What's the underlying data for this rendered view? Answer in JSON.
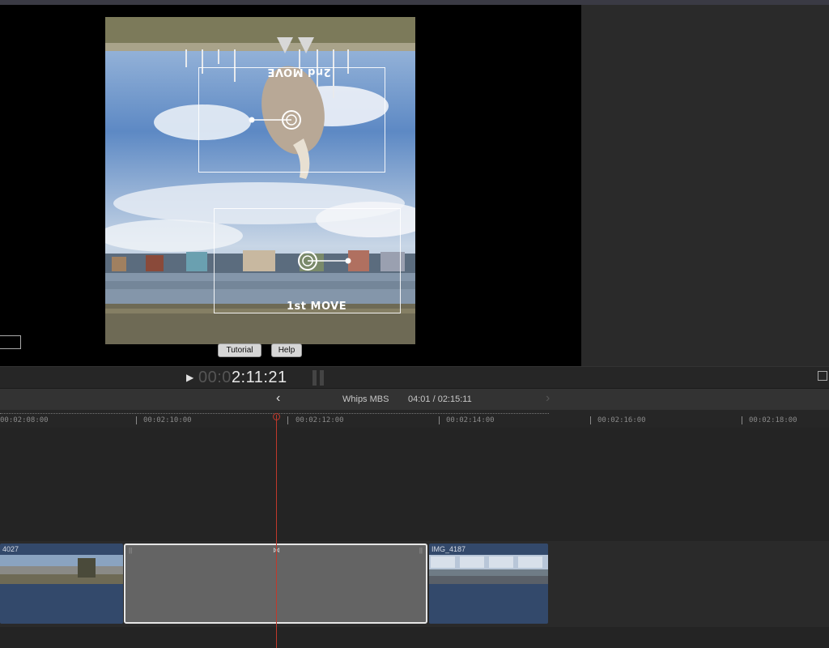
{
  "viewer": {
    "overlay_labels": {
      "second_move": "2nd MOVE",
      "first_move": "1st MOVE"
    },
    "buttons": {
      "tutorial": "Tutorial",
      "help": "Help"
    }
  },
  "transport": {
    "play_icon": "play-icon",
    "timecode_dim": "00:0",
    "timecode_bright": "2:11:21",
    "fullscreen_icon": "fullscreen-icon"
  },
  "navbar": {
    "back_icon": "chevron-left-icon",
    "project_name": "Whips MBS",
    "duration": "04:01 / 02:15:11",
    "forward_icon": "chevron-right-icon"
  },
  "ruler": {
    "ticks": [
      "00:02:08:00",
      "00:02:10:00",
      "00:02:12:00",
      "00:02:14:00",
      "00:02:16:00",
      "00:02:18:00"
    ]
  },
  "timeline": {
    "clips": [
      {
        "name": "4027"
      },
      {
        "name": ""
      },
      {
        "name": "IMG_4187"
      }
    ]
  },
  "colors": {
    "playhead": "#c0392b",
    "clip_blue": "#33496b",
    "selection_border": "#e6e6e6"
  }
}
